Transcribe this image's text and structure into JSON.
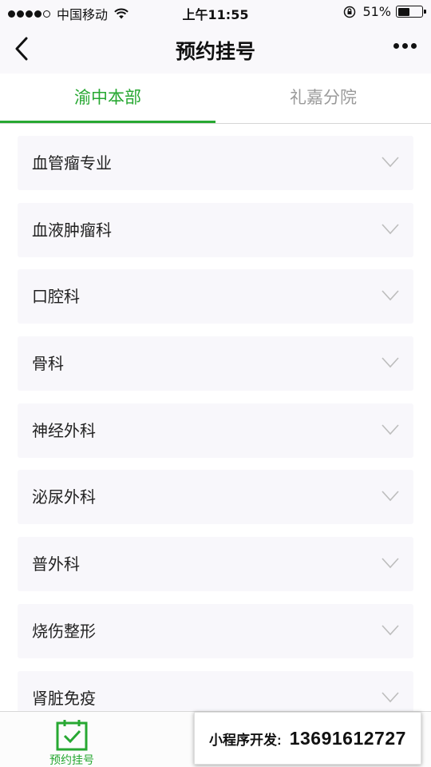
{
  "status_bar": {
    "carrier": "中国移动",
    "time": "上午11:55",
    "battery_percent": "51%",
    "battery_level": 0.51,
    "signal_bars_filled": 4,
    "signal_bars_total": 5
  },
  "nav": {
    "title": "预约挂号",
    "back_icon": "chevron-left-icon",
    "more_icon": "more-dots-icon"
  },
  "tabs": [
    {
      "label": "渝中本部",
      "active": true
    },
    {
      "label": "礼嘉分院",
      "active": false
    }
  ],
  "departments": [
    {
      "label": "血管瘤专业"
    },
    {
      "label": "血液肿瘤科"
    },
    {
      "label": "口腔科"
    },
    {
      "label": "骨科"
    },
    {
      "label": "神经外科"
    },
    {
      "label": "泌尿外科"
    },
    {
      "label": "普外科"
    },
    {
      "label": "烧伤整形"
    },
    {
      "label": "肾脏免疫"
    }
  ],
  "tab_bar": {
    "items": [
      {
        "label": "预约挂号",
        "icon": "calendar-check-icon",
        "active": true
      }
    ]
  },
  "promo": {
    "label": "小程序开发:",
    "phone": "13691612727"
  },
  "colors": {
    "accent": "#27a832",
    "inactive": "#9a9a9a",
    "card_bg": "#f8f7fb"
  }
}
